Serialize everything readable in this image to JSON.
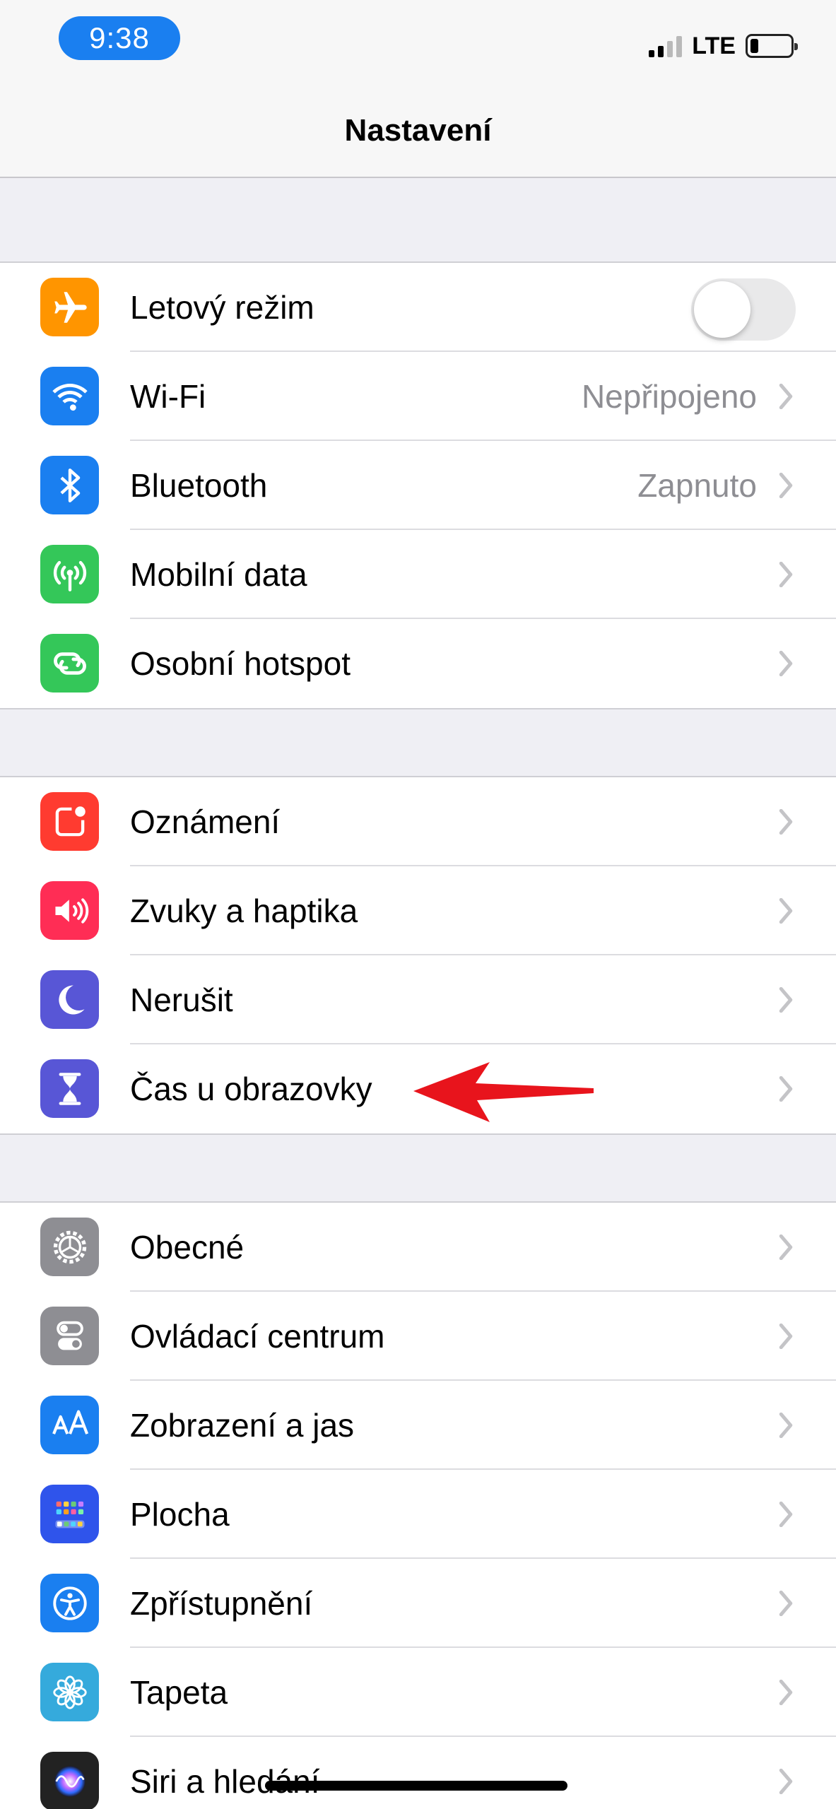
{
  "status_bar": {
    "time": "9:38",
    "network": "LTE",
    "battery_level": 0.12
  },
  "nav": {
    "title": "Nastavení"
  },
  "groups": [
    {
      "rows": [
        {
          "label": "Letový režim",
          "icon": "airplane-icon",
          "icon_bg": "#ff9500",
          "toggle": false
        },
        {
          "label": "Wi-Fi",
          "value": "Nepřipojeno",
          "icon": "wifi-icon",
          "icon_bg": "#1a7ff0"
        },
        {
          "label": "Bluetooth",
          "value": "Zapnuto",
          "icon": "bluetooth-icon",
          "icon_bg": "#1a7ff0"
        },
        {
          "label": "Mobilní data",
          "icon": "antenna-icon",
          "icon_bg": "#34c759"
        },
        {
          "label": "Osobní hotspot",
          "icon": "hotspot-icon",
          "icon_bg": "#34c759"
        }
      ]
    },
    {
      "rows": [
        {
          "label": "Oznámení",
          "icon": "notifications-icon",
          "icon_bg": "#ff3b30"
        },
        {
          "label": "Zvuky a haptika",
          "icon": "speaker-icon",
          "icon_bg": "#ff2d55"
        },
        {
          "label": "Nerušit",
          "icon": "moon-icon",
          "icon_bg": "#5856d6"
        },
        {
          "label": "Čas u obrazovky",
          "icon": "hourglass-icon",
          "icon_bg": "#5856d6"
        }
      ]
    },
    {
      "rows": [
        {
          "label": "Obecné",
          "icon": "gear-icon",
          "icon_bg": "#8e8e93"
        },
        {
          "label": "Ovládací centrum",
          "icon": "switches-icon",
          "icon_bg": "#8e8e93"
        },
        {
          "label": "Zobrazení a jas",
          "icon": "text-size-icon",
          "icon_bg": "#1a7ff0"
        },
        {
          "label": "Plocha",
          "icon": "home-screen-icon",
          "icon_bg": "#2f54eb"
        },
        {
          "label": "Zpřístupnění",
          "icon": "accessibility-icon",
          "icon_bg": "#1a7ff0"
        },
        {
          "label": "Tapeta",
          "icon": "flower-icon",
          "icon_bg": "#35aadc"
        },
        {
          "label": "Siri a hledání",
          "icon": "siri-icon",
          "icon_bg": "#222222"
        }
      ]
    }
  ],
  "colors": {
    "annotation_arrow": "#e8141c",
    "chevron": "#c4c4c7"
  }
}
